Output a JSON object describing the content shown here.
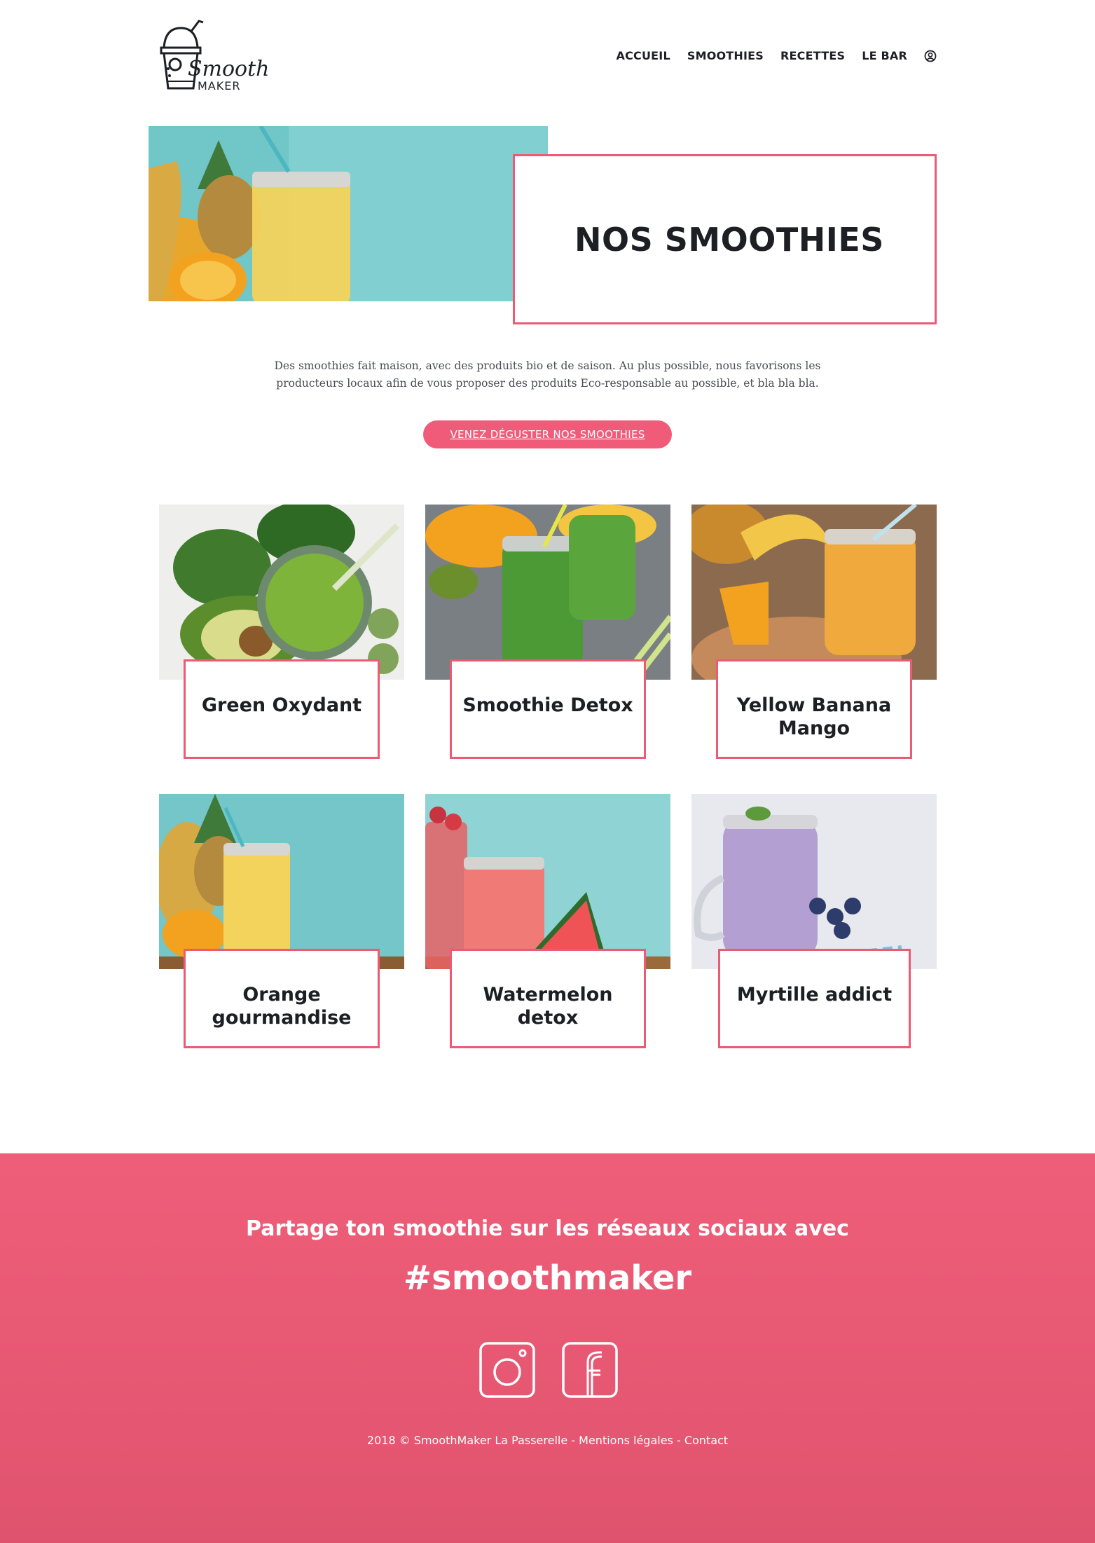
{
  "brand": {
    "logo_script": "Smooth",
    "logo_sub": "MAKER"
  },
  "nav": {
    "items": [
      "ACCUEIL",
      "SMOOTHIES",
      "RECETTES",
      "LE BAR"
    ],
    "user_icon": "user-circle-icon"
  },
  "hero": {
    "title": "NOS SMOOTHIES",
    "image": "pineapple-smoothie-jar"
  },
  "intro": {
    "text": "Des smoothies fait maison, avec des produits bio et de saison. Au plus possible, nous favorisons les producteurs locaux afin de vous proposer des produits Eco-responsable au possible, et bla bla bla."
  },
  "cta": {
    "label": "VENEZ DÉGUSTER NOS SMOOTHIES"
  },
  "smoothies": [
    {
      "name": "Green Oxydant",
      "image": "green-smoothie-avocado"
    },
    {
      "name": "Smoothie Detox",
      "image": "green-smoothie-jars"
    },
    {
      "name": "Yellow Banana Mango",
      "image": "banana-mango-smoothie"
    },
    {
      "name": "Orange gourmandise",
      "image": "orange-pineapple-smoothie"
    },
    {
      "name": "Watermelon detox",
      "image": "watermelon-smoothie"
    },
    {
      "name": "Myrtille addict",
      "image": "blueberry-smoothie"
    }
  ],
  "footer": {
    "headline": "Partage ton smoothie sur les réseaux sociaux avec",
    "hashtag": "#smoothmaker",
    "social": [
      "instagram-icon",
      "facebook-icon"
    ],
    "copyright": "2018 © SmoothMaker La Passerelle - Mentions légales - Contact"
  },
  "colors": {
    "accent": "#ec5a74",
    "footer_top": "#ef5e79",
    "footer_bottom": "#e0536e",
    "text_dark": "#1d1f24"
  }
}
